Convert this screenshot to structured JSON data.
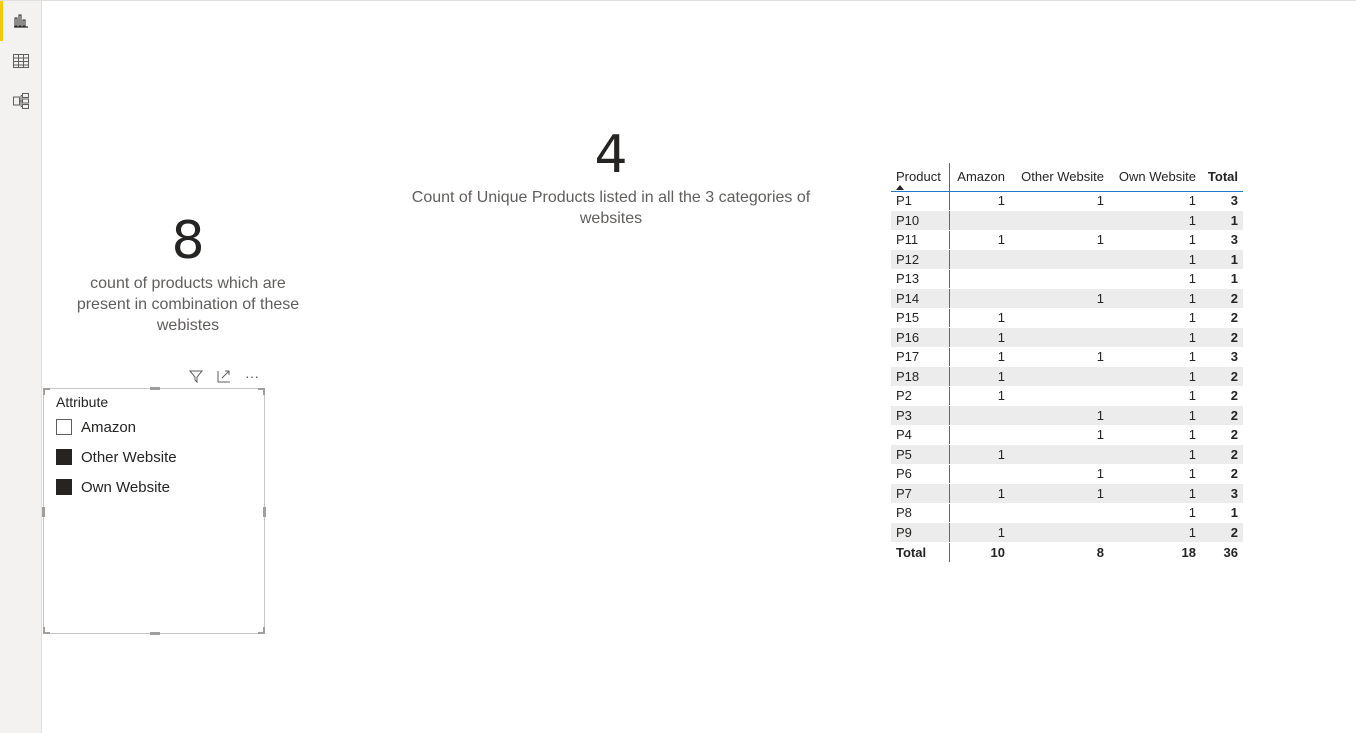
{
  "rail": {
    "items": [
      {
        "name": "report-view",
        "icon": "bar-chart-icon",
        "active": true
      },
      {
        "name": "data-view",
        "icon": "table-grid-icon",
        "active": false
      },
      {
        "name": "model-view",
        "icon": "model-diagram-icon",
        "active": false
      }
    ],
    "accent": "#f2c811"
  },
  "card_unique": {
    "value": "4",
    "label": "Count of Unique Products listed in all the 3 categories of websites"
  },
  "card_combination": {
    "value": "8",
    "label": "count of products which are present in combination of these webistes"
  },
  "slicer": {
    "title": "Attribute",
    "items": [
      {
        "label": "Amazon",
        "checked": false
      },
      {
        "label": "Other Website",
        "checked": true
      },
      {
        "label": "Own Website",
        "checked": true
      }
    ],
    "header_icons": [
      "filter-icon",
      "focus-mode-icon",
      "more-options-icon"
    ],
    "more_glyph": "···"
  },
  "matrix": {
    "columns": [
      "Product",
      "Amazon",
      "Other Website",
      "Own Website",
      "Total"
    ],
    "rows": [
      [
        "P1",
        "1",
        "1",
        "1",
        "3"
      ],
      [
        "P10",
        "",
        "",
        "1",
        "1"
      ],
      [
        "P11",
        "1",
        "1",
        "1",
        "3"
      ],
      [
        "P12",
        "",
        "",
        "1",
        "1"
      ],
      [
        "P13",
        "",
        "",
        "1",
        "1"
      ],
      [
        "P14",
        "",
        "1",
        "1",
        "2"
      ],
      [
        "P15",
        "1",
        "",
        "1",
        "2"
      ],
      [
        "P16",
        "1",
        "",
        "1",
        "2"
      ],
      [
        "P17",
        "1",
        "1",
        "1",
        "3"
      ],
      [
        "P18",
        "1",
        "",
        "1",
        "2"
      ],
      [
        "P2",
        "1",
        "",
        "1",
        "2"
      ],
      [
        "P3",
        "",
        "1",
        "1",
        "2"
      ],
      [
        "P4",
        "",
        "1",
        "1",
        "2"
      ],
      [
        "P5",
        "1",
        "",
        "1",
        "2"
      ],
      [
        "P6",
        "",
        "1",
        "1",
        "2"
      ],
      [
        "P7",
        "1",
        "1",
        "1",
        "3"
      ],
      [
        "P8",
        "",
        "",
        "1",
        "1"
      ],
      [
        "P9",
        "1",
        "",
        "1",
        "2"
      ]
    ],
    "total_row": [
      "Total",
      "10",
      "8",
      "18",
      "36"
    ]
  }
}
